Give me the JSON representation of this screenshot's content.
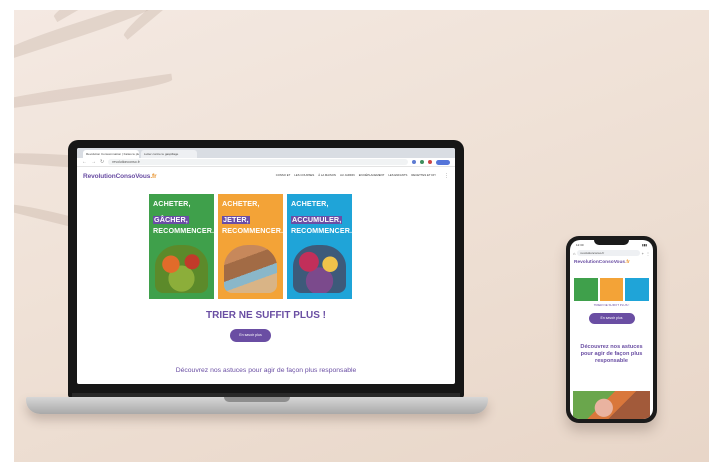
{
  "laptop": {
    "tabs": [
      "Revolution Consommation | Faites le plein d'Idées",
      "Lutter contre le gaspillage"
    ],
    "url": "revolutionconso.fr",
    "logo": {
      "main": "RevolutionConsoVous",
      "accent": ".fr"
    },
    "menu": [
      "CONSO ET",
      "LES COURSES",
      "À LA MAISON",
      "AU JARDIN",
      "EN DÉPLACEMENT",
      "LES ENFANTS",
      "RECETTES ET DIY"
    ],
    "posters": [
      {
        "lines": [
          "ACHETER,",
          "GÂCHER,",
          "RECOMMENCER..."
        ],
        "highlight": 1,
        "color": "#3fa04b"
      },
      {
        "lines": [
          "ACHETER,",
          "JETER,",
          "RECOMMENCER..."
        ],
        "highlight": 1,
        "color": "#f3a337"
      },
      {
        "lines": [
          "ACHETER,",
          "ACCUMULER,",
          "RECOMMENCER..."
        ],
        "highlight": 1,
        "color": "#1fa4d8"
      }
    ],
    "headline": "TRIER NE SUFFIT PLUS !",
    "button": "En savoir plus",
    "subtitle": "Découvrez nos astuces pour agir de façon plus responsable"
  },
  "phone": {
    "status_time": "12:30",
    "url": "revolutionconso.fr",
    "logo": {
      "main": "RevolutionConsoVous",
      "accent": ".fr"
    },
    "tagline": "TRIER NE SUFFIT PLUS !",
    "button": "En savoir plus",
    "title": "Découvrez nos astuces pour agir de façon plus responsable"
  },
  "colors": {
    "brand": "#6a4ea3",
    "accent": "#e8932d",
    "background": "#efe1d6"
  }
}
